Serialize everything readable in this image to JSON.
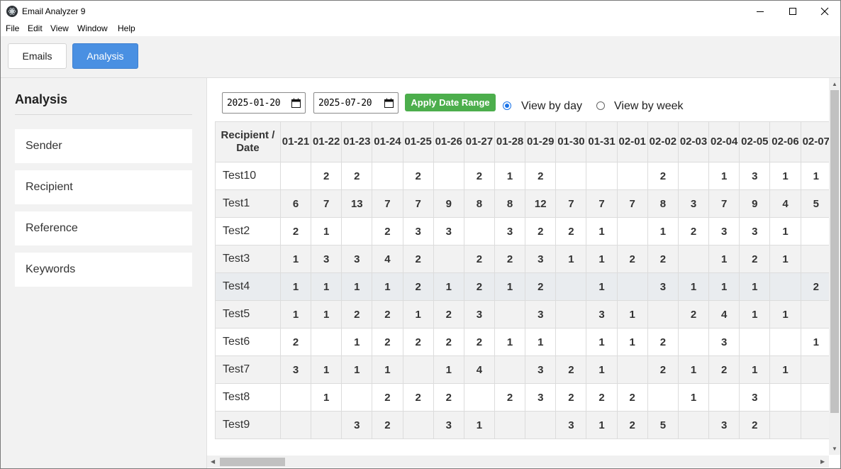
{
  "window": {
    "title": "Email Analyzer 9"
  },
  "menu": [
    "File",
    "Edit",
    "View",
    "Window",
    "Help"
  ],
  "tabs": [
    {
      "label": "Emails",
      "active": false
    },
    {
      "label": "Analysis",
      "active": true
    }
  ],
  "sidebar": {
    "title": "Analysis",
    "items": [
      {
        "label": "Sender"
      },
      {
        "label": "Recipient"
      },
      {
        "label": "Reference"
      },
      {
        "label": "Keywords"
      }
    ]
  },
  "filters": {
    "start_date": "2025-01-20",
    "end_date": "2025-07-20",
    "apply_label": "Apply Date Range",
    "view_day_label": "View by day",
    "view_week_label": "View by week",
    "selected_view": "day"
  },
  "table": {
    "header_label": "Recipient / Date",
    "columns": [
      "01-21",
      "01-22",
      "01-23",
      "01-24",
      "01-25",
      "01-26",
      "01-27",
      "01-28",
      "01-29",
      "01-30",
      "01-31",
      "02-01",
      "02-02",
      "02-03",
      "02-04",
      "02-05",
      "02-06",
      "02-07"
    ],
    "rows": [
      {
        "name": "Test10",
        "values": [
          "",
          "2",
          "2",
          "",
          "2",
          "",
          "2",
          "1",
          "2",
          "",
          "",
          "",
          "2",
          "",
          "1",
          "3",
          "1",
          "1"
        ]
      },
      {
        "name": "Test1",
        "values": [
          "6",
          "7",
          "13",
          "7",
          "7",
          "9",
          "8",
          "8",
          "12",
          "7",
          "7",
          "7",
          "8",
          "3",
          "7",
          "9",
          "4",
          "5"
        ]
      },
      {
        "name": "Test2",
        "values": [
          "2",
          "1",
          "",
          "2",
          "3",
          "3",
          "",
          "3",
          "2",
          "2",
          "1",
          "",
          "1",
          "2",
          "3",
          "3",
          "1",
          ""
        ]
      },
      {
        "name": "Test3",
        "values": [
          "1",
          "3",
          "3",
          "4",
          "2",
          "",
          "2",
          "2",
          "3",
          "1",
          "1",
          "2",
          "2",
          "",
          "1",
          "2",
          "1",
          ""
        ]
      },
      {
        "name": "Test4",
        "values": [
          "1",
          "1",
          "1",
          "1",
          "2",
          "1",
          "2",
          "1",
          "2",
          "",
          "1",
          "",
          "3",
          "1",
          "1",
          "1",
          "",
          "2"
        ]
      },
      {
        "name": "Test5",
        "values": [
          "1",
          "1",
          "2",
          "2",
          "1",
          "2",
          "3",
          "",
          "3",
          "",
          "3",
          "1",
          "",
          "2",
          "4",
          "1",
          "1",
          ""
        ]
      },
      {
        "name": "Test6",
        "values": [
          "2",
          "",
          "1",
          "2",
          "2",
          "2",
          "2",
          "1",
          "1",
          "",
          "1",
          "1",
          "2",
          "",
          "3",
          "",
          "",
          "1"
        ]
      },
      {
        "name": "Test7",
        "values": [
          "3",
          "1",
          "1",
          "1",
          "",
          "1",
          "4",
          "",
          "3",
          "2",
          "1",
          "",
          "2",
          "1",
          "2",
          "1",
          "1",
          ""
        ]
      },
      {
        "name": "Test8",
        "values": [
          "",
          "1",
          "",
          "2",
          "2",
          "2",
          "",
          "2",
          "3",
          "2",
          "2",
          "2",
          "",
          "1",
          "",
          "3",
          "",
          ""
        ]
      },
      {
        "name": "Test9",
        "values": [
          "",
          "",
          "3",
          "2",
          "",
          "3",
          "1",
          "",
          "",
          "3",
          "1",
          "2",
          "5",
          "",
          "3",
          "2",
          "",
          ""
        ]
      }
    ],
    "highlighted_row": 4
  },
  "colors": {
    "accent": "#4a90e2",
    "apply_button": "#4cae4c",
    "radio": "#1a73e8"
  }
}
